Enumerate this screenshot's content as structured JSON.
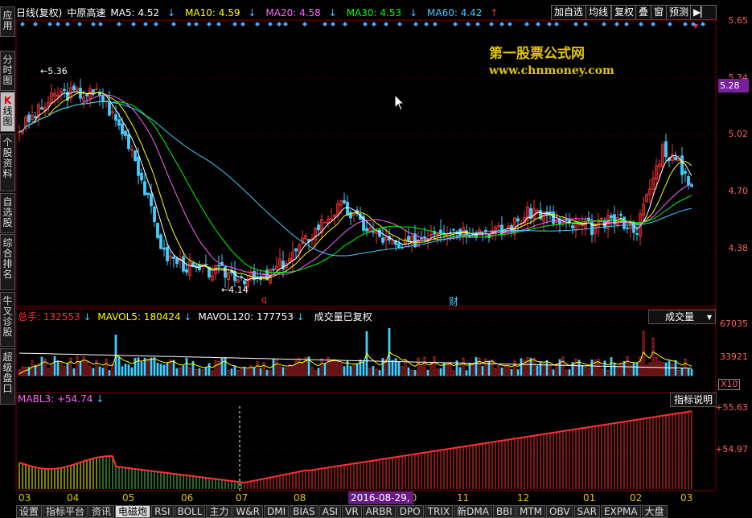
{
  "left_tabs": [
    {
      "label": "应\n用",
      "active": false
    },
    {
      "label": "分\n时\n图",
      "active": false
    },
    {
      "label": "K\n线\n图",
      "active": true
    },
    {
      "label": "个\n股\n资\n料",
      "active": false
    },
    {
      "label": "自\n选\n股",
      "active": false
    },
    {
      "label": "综\n合\n排\n名",
      "active": false
    },
    {
      "label": "牛\n叉\n诊\n股",
      "active": false
    },
    {
      "label": "超\n级\n盘\n口",
      "active": false
    }
  ],
  "header": {
    "period": "日线(复权)",
    "stock_name": "中原高速",
    "ma5": "MA5: 4.52",
    "ma10": "MA10: 4.59",
    "ma20": "MA20: 4.58",
    "ma30": "MA30: 4.53",
    "ma60": "MA60: 4.42",
    "ma5_dir": "↓",
    "ma10_dir": "↓",
    "ma20_dir": "↓",
    "ma30_dir": "↓",
    "ma60_dir": "↑"
  },
  "toolbar": {
    "add_watch": "加自选",
    "ma_line": "均线",
    "adjust": "复权",
    "overlay": "叠",
    "window": "窗",
    "forecast": "预测",
    "nav": "▶▏"
  },
  "watermark": {
    "line1": "第一股票公式网",
    "line2": "www.chnmoney.com"
  },
  "price_axis": [
    "5.65",
    "5.34",
    "5.02",
    "4.70",
    "4.38"
  ],
  "current_price": "5.28",
  "annotations": {
    "high": "5.36",
    "low": "4.14",
    "q_marker": "q",
    "cai_marker": "财"
  },
  "volume_panel": {
    "total": "总手: 132553",
    "total_dir": "↓",
    "mavol5": "MAVOL5: 180424",
    "mavol5_dir": "↓",
    "mavol120": "MAVOL120: 177753",
    "mavol120_dir": "↓",
    "note": "成交量已复权",
    "dropdown": "成交量",
    "axis": [
      "67035",
      "33921"
    ],
    "unit": "X10"
  },
  "indicator_panel": {
    "name": "MABL3: +54.74",
    "dir": "↓",
    "help_button": "指标说明",
    "axis": [
      "+55.63",
      "+54.97"
    ]
  },
  "months": [
    "03",
    "04",
    "05",
    "06",
    "07",
    "08",
    "10",
    "11",
    "12",
    "01",
    "02",
    "03"
  ],
  "date_cursor": "2016-08-29,一",
  "bottom_tabs": [
    "设置",
    "指标平台",
    "资讯",
    "电磁炮",
    "RSI",
    "BOLL",
    "主力",
    "W&R",
    "DMI",
    "BIAS",
    "ASI",
    "VR",
    "ARBR",
    "DPO",
    "TRIX",
    "新DMA",
    "BBI",
    "MTM",
    "OBV",
    "SAR",
    "EXPMA",
    "大盘"
  ],
  "active_bottom_tab": "电磁炮",
  "colors": {
    "up": "#ff3030",
    "down": "#44ccff",
    "ma5": "#ffffff",
    "ma10": "#ffff00",
    "ma20": "#ff66ff",
    "ma30": "#00ff00",
    "ma60": "#44ccff",
    "axis": "#ff6060",
    "accent": "#7a1fa0"
  }
}
